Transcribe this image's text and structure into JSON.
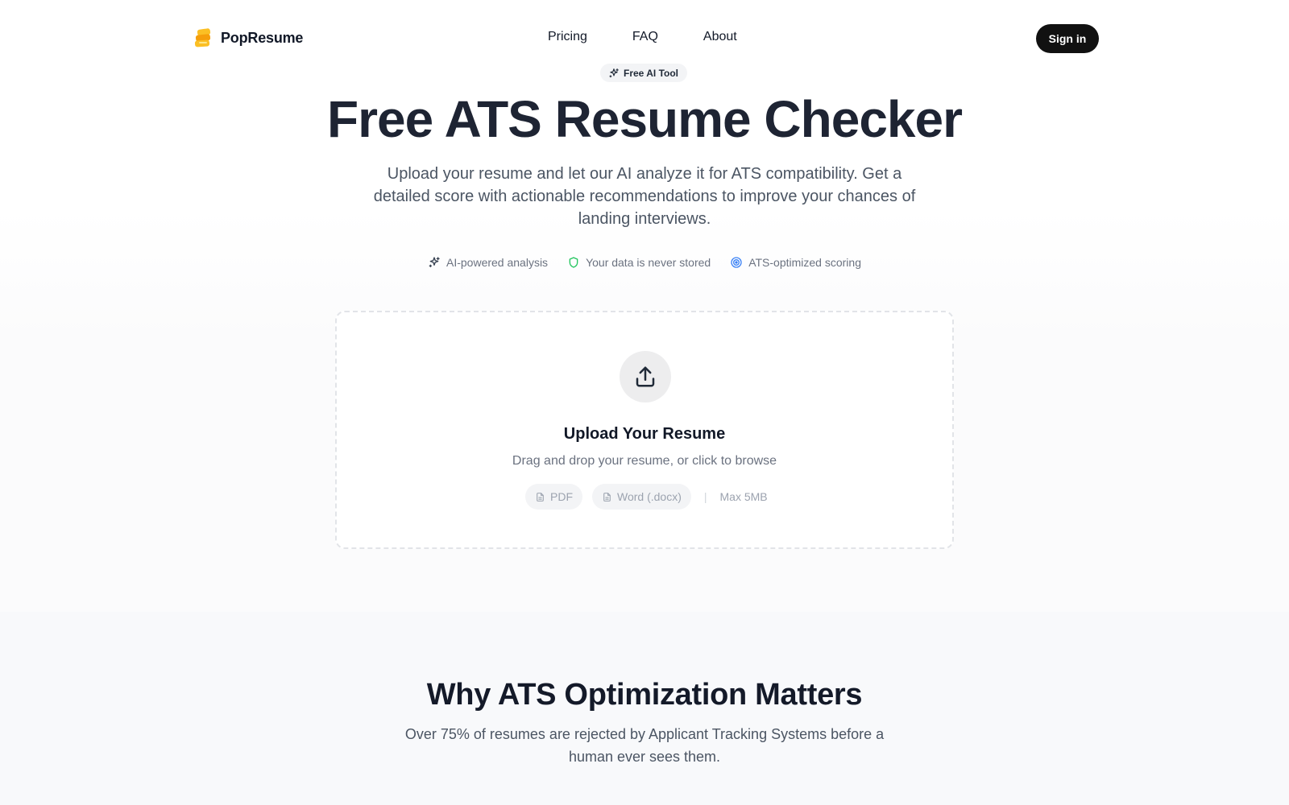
{
  "header": {
    "brand_name": "PopResume",
    "nav": [
      {
        "label": "Pricing"
      },
      {
        "label": "FAQ"
      },
      {
        "label": "About"
      }
    ],
    "signin_label": "Sign in"
  },
  "hero": {
    "badge": "Free AI Tool",
    "title": "Free ATS Resume Checker",
    "subtitle": "Upload your resume and let our AI analyze it for ATS compatibility. Get a detailed score with actionable recommendations to improve your chances of landing interviews.",
    "features": [
      {
        "icon": "sparkles-icon",
        "label": "AI-powered analysis"
      },
      {
        "icon": "shield-icon",
        "label": "Your data is never stored",
        "color": "#22c55e"
      },
      {
        "icon": "target-icon",
        "label": "ATS-optimized scoring",
        "color": "#3b82f6"
      }
    ]
  },
  "upload": {
    "icon": "upload-icon",
    "title": "Upload Your Resume",
    "subtitle": "Drag and drop your resume, or click to browse",
    "formats": [
      {
        "icon": "file-icon",
        "label": "PDF"
      },
      {
        "icon": "file-icon",
        "label": "Word (.docx)"
      }
    ],
    "separator": "|",
    "max_size": "Max 5MB"
  },
  "why": {
    "title": "Why ATS Optimization Matters",
    "subtitle": "Over 75% of resumes are rejected by Applicant Tracking Systems before a human ever sees them."
  },
  "colors": {
    "primary_dark": "#111111",
    "brand_logo": "#f5a623",
    "shield": "#22c55e",
    "target": "#3b82f6"
  }
}
